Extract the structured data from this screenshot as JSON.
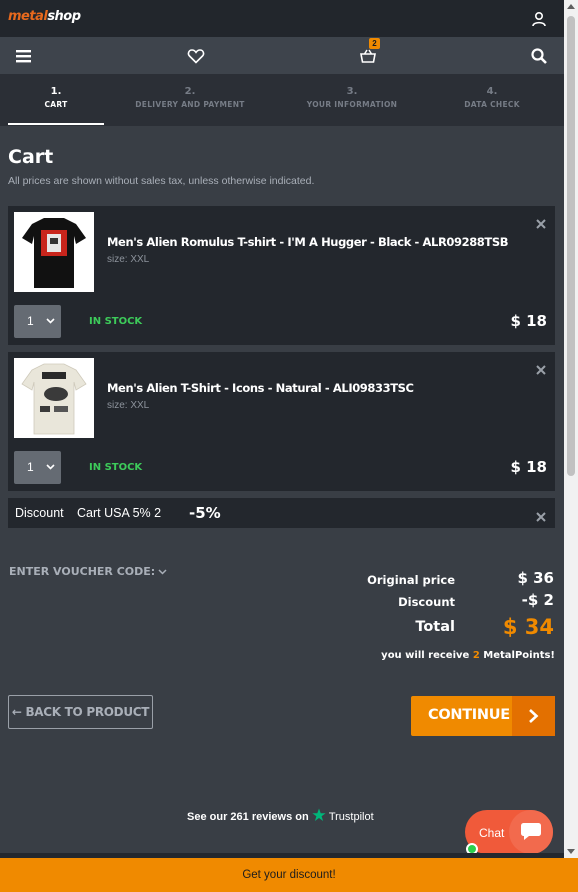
{
  "header": {
    "logo_prefix": "metal",
    "logo_suffix": "shop",
    "cart_count": "2",
    "icons": [
      "user-icon",
      "menu-icon",
      "heart-icon",
      "basket-icon",
      "search-icon"
    ]
  },
  "steps": [
    {
      "num": "1.",
      "label": "CART",
      "active": true
    },
    {
      "num": "2.",
      "label": "DELIVERY AND PAYMENT",
      "active": false
    },
    {
      "num": "3.",
      "label": "YOUR INFORMATION",
      "active": false
    },
    {
      "num": "4.",
      "label": "DATA CHECK",
      "active": false
    }
  ],
  "page": {
    "title": "Cart",
    "subtitle": "All prices are shown without sales tax, unless otherwise indicated."
  },
  "items": [
    {
      "name": "Men's Alien Romulus T-shirt - I'M A Hugger - Black - ALR09288TSB",
      "size": "size: XXL",
      "qty": "1",
      "stock": "IN STOCK",
      "price": "$ 18"
    },
    {
      "name": "Men's Alien T-Shirt - Icons - Natural - ALI09833TSC",
      "size": "size: XXL",
      "qty": "1",
      "stock": "IN STOCK",
      "price": "$ 18"
    }
  ],
  "discount": {
    "label": "Discount",
    "name": "Cart USA 5% 2",
    "value": "-5%"
  },
  "voucher": {
    "label": "ENTER VOUCHER CODE:"
  },
  "summary": {
    "original_label": "Original price",
    "original_value": "$ 36",
    "discount_label": "Discount",
    "discount_value": "-$ 2",
    "total_label": "Total",
    "total_value": "$ 34",
    "points_prefix": "you will receive",
    "points_num": "2",
    "points_suffix": "MetalPoints!"
  },
  "buttons": {
    "back": "← BACK TO PRODUCT",
    "continue": "CONTINUE"
  },
  "trustpilot": {
    "prefix": "See our",
    "count": "261",
    "middle": "reviews on",
    "brand": "Trustpilot"
  },
  "chat": {
    "label": "Chat"
  },
  "bottom_bar": {
    "text": "Get your discount!"
  },
  "colors": {
    "accent": "#f08a00",
    "stock_green": "#3dcb5a",
    "chat": "#f05a3a"
  }
}
